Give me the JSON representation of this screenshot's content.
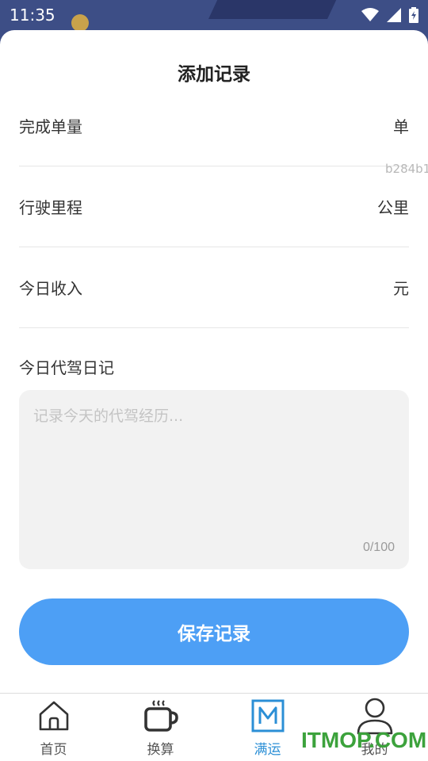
{
  "status_bar": {
    "time": "11:35"
  },
  "sheet": {
    "title": "添加记录"
  },
  "fields": [
    {
      "label": "完成单量",
      "unit": "单",
      "value": ""
    },
    {
      "label": "行驶里程",
      "unit": "公里",
      "value": ""
    },
    {
      "label": "今日收入",
      "unit": "元",
      "value": ""
    }
  ],
  "overlay_code": "b284b1",
  "diary": {
    "label": "今日代驾日记",
    "placeholder": "记录今天的代驾经历...",
    "counter": "0/100"
  },
  "save_button": {
    "label": "保存记录"
  },
  "tabbar": {
    "items": [
      {
        "label": "首页",
        "icon": "home-icon"
      },
      {
        "label": "换算",
        "icon": "cup-icon"
      },
      {
        "label": "满运",
        "icon": "m-logo-icon"
      },
      {
        "label": "我的",
        "icon": "user-icon"
      }
    ],
    "active_index": 2
  },
  "site_watermark": "ITMOP.COM",
  "colors": {
    "accent": "#4d9ff5",
    "tab_active": "#2b8fd6",
    "watermark": "#3ca23c"
  }
}
